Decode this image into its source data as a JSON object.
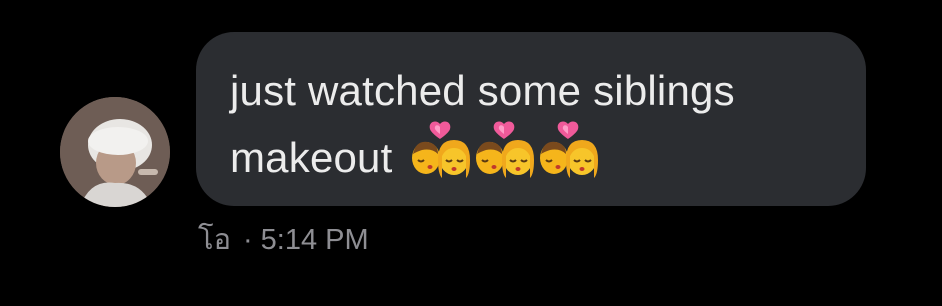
{
  "message": {
    "line1": "just watched some siblings",
    "line2": "makeout",
    "emoji_icons": [
      "kiss-emoji-icon",
      "kiss-emoji-icon",
      "kiss-emoji-icon"
    ]
  },
  "meta": {
    "sender": "โอ",
    "separator": "·",
    "time": "5:14 PM"
  },
  "colors": {
    "background": "#000000",
    "bubble": "#2b2d31",
    "text": "#ececec",
    "meta_text": "#8e8e93"
  }
}
